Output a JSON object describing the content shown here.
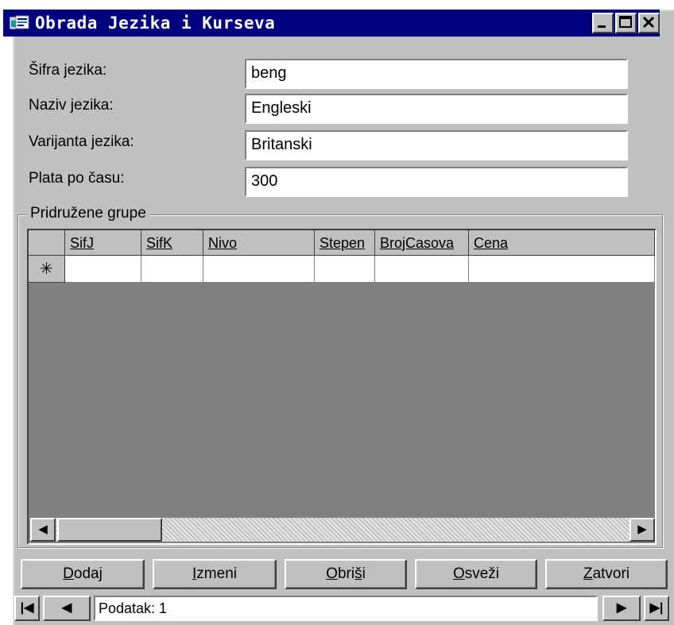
{
  "window": {
    "title": "Obrada Jezika i Kurseva",
    "icon": "form-icon",
    "buttons": [
      "minimize-icon",
      "maximize-icon",
      "close-icon"
    ]
  },
  "form": {
    "fields": [
      {
        "label": "Šifra jezika:",
        "value": "beng"
      },
      {
        "label": "Naziv jezika:",
        "value": "Engleski"
      },
      {
        "label": "Varijanta jezika:",
        "value": "Britanski"
      },
      {
        "label": "Plata po času:",
        "value": "300"
      }
    ]
  },
  "group": {
    "label": "Pridružene grupe",
    "columns": [
      "SifJ",
      "SifK",
      "Nivo",
      "Stepen",
      "BrojCasova",
      "Cena"
    ],
    "new_row_marker": "✳",
    "scroll_left": "◀",
    "scroll_right": "▶"
  },
  "buttons": [
    {
      "accel": "D",
      "rest": "odaj"
    },
    {
      "accel": "I",
      "rest": "zmeni"
    },
    {
      "accel": "O",
      "mid": "bri",
      "accel2": "š",
      "rest": "i"
    },
    {
      "accel": "O",
      "rest": "sveži"
    },
    {
      "accel": "Z",
      "rest": "atvori"
    }
  ],
  "navigation": {
    "record_text": "Podatak: 1",
    "first": "|◀",
    "prev": "◀",
    "next": "▶",
    "last": "▶|"
  },
  "colors": {
    "titlebar": "#000080",
    "face": "#c0c0c0",
    "grid_background": "#808080"
  }
}
